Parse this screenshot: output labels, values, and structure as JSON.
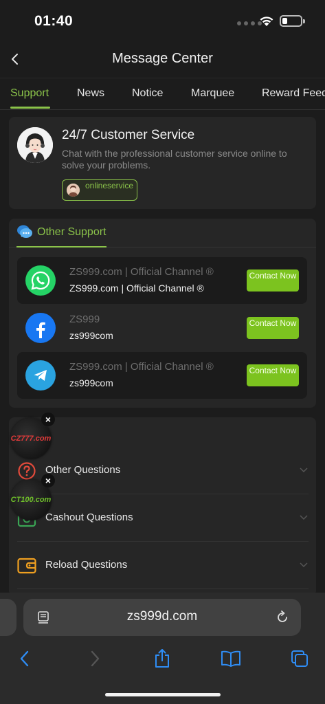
{
  "status_bar": {
    "time": "01:40"
  },
  "header": {
    "title": "Message Center"
  },
  "tabs": [
    {
      "label": "Support",
      "active": true
    },
    {
      "label": "News",
      "active": false
    },
    {
      "label": "Notice",
      "active": false
    },
    {
      "label": "Marquee",
      "active": false
    },
    {
      "label": "Reward Feed",
      "active": false
    }
  ],
  "customer_service": {
    "title": "24/7 Customer Service",
    "description": "Chat with the professional customer service online to solve your problems.",
    "button_label": "onlineservice"
  },
  "other_support": {
    "title": "Other Support",
    "channels": [
      {
        "icon": "whatsapp-icon",
        "name": "ZS999.com | Official Channel ®",
        "handle": "ZS999.com | Official Channel ®",
        "button": "Contact Now"
      },
      {
        "icon": "facebook-icon",
        "name": "ZS999",
        "handle": "zs999com",
        "button": "Contact Now"
      },
      {
        "icon": "telegram-icon",
        "name": "ZS999.com | Official Channel ®",
        "handle": "zs999com",
        "button": "Contact Now"
      }
    ]
  },
  "faq": [
    {
      "icon": "question-circle-icon",
      "label": "Other Questions"
    },
    {
      "icon": "cashout-icon",
      "label": "Cashout Questions"
    },
    {
      "icon": "wallet-icon",
      "label": "Reload Questions"
    }
  ],
  "floating_ads": [
    {
      "brand": "CZ777.com"
    },
    {
      "brand": "CT100.com"
    }
  ],
  "browser": {
    "url": "zs999d.com"
  },
  "colors": {
    "accent": "#8bc34a",
    "button": "#7cc31f",
    "background": "#1c1c1c",
    "card": "#262626"
  }
}
